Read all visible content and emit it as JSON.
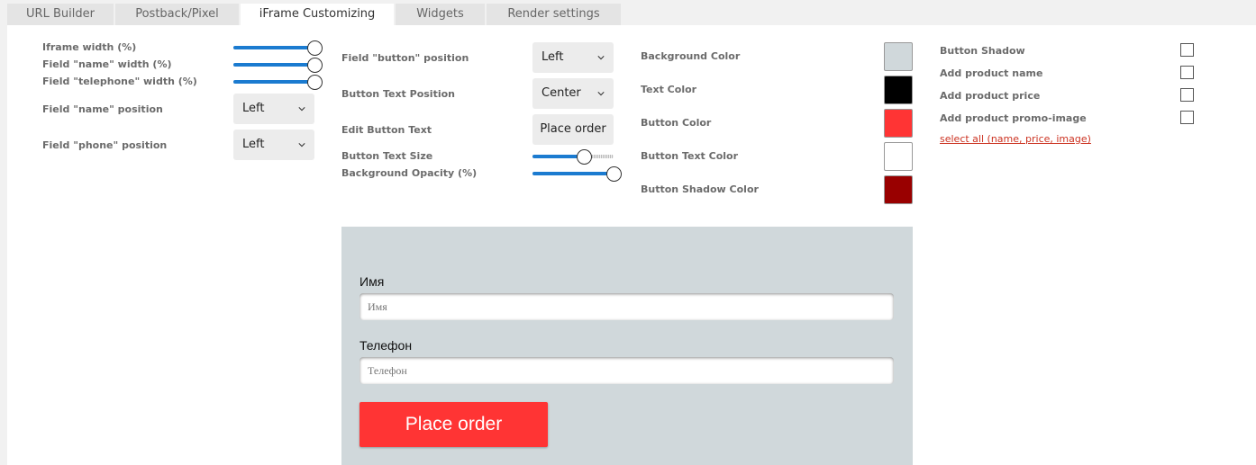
{
  "tabs": [
    {
      "label": "URL Builder"
    },
    {
      "label": "Postback/Pixel"
    },
    {
      "label": "iFrame Customizing",
      "active": true
    },
    {
      "label": "Widgets"
    },
    {
      "label": "Render settings"
    }
  ],
  "col1": {
    "iframe_width_label": "Iframe width (%)",
    "iframe_width_value": 1.0,
    "name_width_label": "Field \"name\" width (%)",
    "name_width_value": 1.0,
    "telephone_width_label": "Field \"telephone\" width (%)",
    "telephone_width_value": 1.0,
    "name_position_label": "Field \"name\" position",
    "name_position_value": "Left",
    "phone_position_label": "Field \"phone\" position",
    "phone_position_value": "Left"
  },
  "col2": {
    "button_position_label": "Field \"button\" position",
    "button_position_value": "Left",
    "button_text_position_label": "Button Text Position",
    "button_text_position_value": "Center",
    "edit_button_text_label": "Edit Button Text",
    "edit_button_text_value": "Place order",
    "button_text_size_label": "Button Text Size",
    "button_text_size_value": 0.63,
    "background_opacity_label": "Background Opacity (%)",
    "background_opacity_value": 1.0
  },
  "col3": {
    "background_color_label": "Background Color",
    "background_color": "#d0d8db",
    "text_color_label": "Text Color",
    "text_color": "#000000",
    "button_color_label": "Button Color",
    "button_color": "#ff3434",
    "button_text_color_label": "Button Text Color",
    "button_text_color": "#ffffff",
    "button_shadow_color_label": "Button Shadow Color",
    "button_shadow_color": "#990000"
  },
  "col4": {
    "button_shadow_label": "Button Shadow",
    "add_product_name_label": "Add product name",
    "add_product_price_label": "Add product price",
    "add_product_promo_label": "Add product promo-image",
    "select_all_link": "select all (name, price, image)"
  },
  "preview": {
    "name_label": "Имя",
    "name_placeholder": "Имя",
    "phone_label": "Телефон",
    "phone_placeholder": "Телефон",
    "button_label": "Place order"
  }
}
